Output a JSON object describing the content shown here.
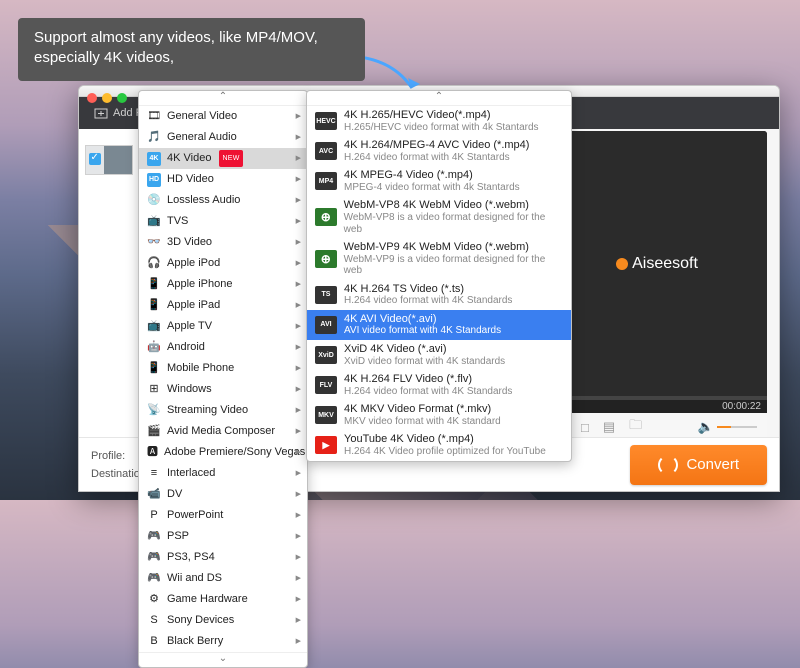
{
  "callout": {
    "text": "Support almost any videos, like MP4/MOV, especially 4K videos,"
  },
  "toolbar": {
    "add_file": "Add File"
  },
  "bottom": {
    "profile_label": "Profile:",
    "destination_label": "Destination:",
    "convert": "Convert"
  },
  "preview": {
    "brand": "Aiseesoft",
    "time": "00:00:22"
  },
  "categories": [
    {
      "icon": "🎞",
      "label": "General Video"
    },
    {
      "icon": "🎵",
      "label": "General Audio"
    },
    {
      "icon": "4K",
      "label": "4K Video",
      "new": "NEW",
      "selected": true,
      "badge": true
    },
    {
      "icon": "HD",
      "label": "HD Video",
      "badge": true
    },
    {
      "icon": "💿",
      "label": "Lossless Audio"
    },
    {
      "icon": "📺",
      "label": "TVS"
    },
    {
      "icon": "👓",
      "label": "3D Video"
    },
    {
      "icon": "🎧",
      "label": "Apple iPod"
    },
    {
      "icon": "📱",
      "label": "Apple iPhone"
    },
    {
      "icon": "📱",
      "label": "Apple iPad"
    },
    {
      "icon": "📺",
      "label": "Apple TV"
    },
    {
      "icon": "🤖",
      "label": "Android"
    },
    {
      "icon": "📱",
      "label": "Mobile Phone"
    },
    {
      "icon": "⊞",
      "label": "Windows"
    },
    {
      "icon": "📡",
      "label": "Streaming Video"
    },
    {
      "icon": "🎬",
      "label": "Avid Media Composer"
    },
    {
      "icon": "🅰",
      "label": "Adobe Premiere/Sony Vegas"
    },
    {
      "icon": "≡",
      "label": "Interlaced"
    },
    {
      "icon": "📹",
      "label": "DV"
    },
    {
      "icon": "P",
      "label": "PowerPoint"
    },
    {
      "icon": "🎮",
      "label": "PSP"
    },
    {
      "icon": "🎮",
      "label": "PS3, PS4"
    },
    {
      "icon": "🎮",
      "label": "Wii and DS"
    },
    {
      "icon": "⚙",
      "label": "Game Hardware"
    },
    {
      "icon": "S",
      "label": "Sony Devices"
    },
    {
      "icon": "B",
      "label": "Black Berry"
    }
  ],
  "subitems": [
    {
      "icon": "HEVC",
      "t1": "4K H.265/HEVC Video(*.mp4)",
      "t2": "H.265/HEVC video format with 4k Stantards"
    },
    {
      "icon": "AVC",
      "t1": "4K H.264/MPEG-4 AVC Video (*.mp4)",
      "t2": "H.264 video format with 4K Stantards"
    },
    {
      "icon": "MP4",
      "t1": "4K MPEG-4 Video (*.mp4)",
      "t2": "MPEG-4 video format with 4k Stantards"
    },
    {
      "icon": "web",
      "t1": "WebM-VP8 4K WebM Video (*.webm)",
      "t2": "WebM-VP8 is a video format designed for the web",
      "web": true
    },
    {
      "icon": "web",
      "t1": "WebM-VP9 4K WebM Video (*.webm)",
      "t2": "WebM-VP9 is a video format designed for the web",
      "web": true
    },
    {
      "icon": "TS",
      "t1": "4K H.264 TS Video (*.ts)",
      "t2": "H.264 video format with 4K Standards"
    },
    {
      "icon": "AVI",
      "t1": "4K AVI Video(*.avi)",
      "t2": "AVI video format with 4K Standards",
      "selected": true
    },
    {
      "icon": "XviD",
      "t1": "XviD 4K Video (*.avi)",
      "t2": "XviD video format with 4K standards"
    },
    {
      "icon": "FLV",
      "t1": "4K H.264 FLV Video (*.flv)",
      "t2": "H.264 video format with 4K Standards"
    },
    {
      "icon": "MKV",
      "t1": "4K MKV Video Format (*.mkv)",
      "t2": "MKV video format with 4K standard"
    },
    {
      "icon": "▶",
      "t1": "YouTube 4K Video (*.mp4)",
      "t2": "H.264 4K Video profile optimized for YouTube",
      "yt": true
    }
  ],
  "ui": {
    "up_arrow": "⌃",
    "down_arrow": "⌄"
  }
}
